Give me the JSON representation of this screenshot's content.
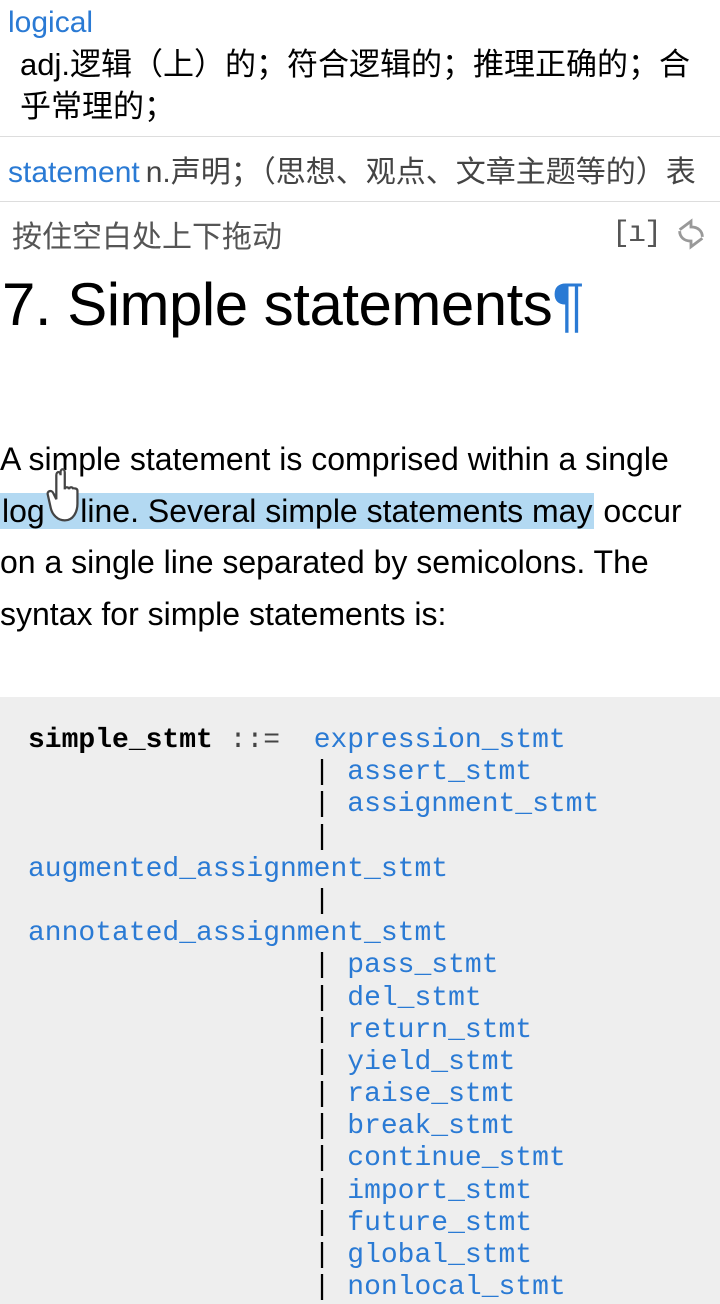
{
  "dict": {
    "entry1": {
      "word": "logical",
      "definition": "adj.逻辑（上）的；符合逻辑的；推理正确的；合乎常理的；"
    },
    "entry2": {
      "word": "statement",
      "definition": "n.声明；（思想、观点、文章主题等的）表"
    }
  },
  "toolbar": {
    "hint": "按住空白处上下拖动",
    "brackets": "[ı]"
  },
  "heading": {
    "text": "7. Simple statements",
    "pilcrow": "¶"
  },
  "paragraph": {
    "part1": "A simple statement is comprised within a single ",
    "highlighted_prefix": "log",
    "highlighted_rest": " line. Several simple statements may",
    "part2": " occur on a single line separated by semicolons. The syntax for simple statements is:"
  },
  "code": {
    "lhs": "simple_stmt",
    "op": "::=",
    "rules": [
      "expression_stmt",
      "assert_stmt",
      "assignment_stmt",
      "augmented_assignment_stmt",
      "annotated_assignment_stmt",
      "pass_stmt",
      "del_stmt",
      "return_stmt",
      "yield_stmt",
      "raise_stmt",
      "break_stmt",
      "continue_stmt",
      "import_stmt",
      "future_stmt",
      "global_stmt",
      "nonlocal_stmt"
    ]
  }
}
